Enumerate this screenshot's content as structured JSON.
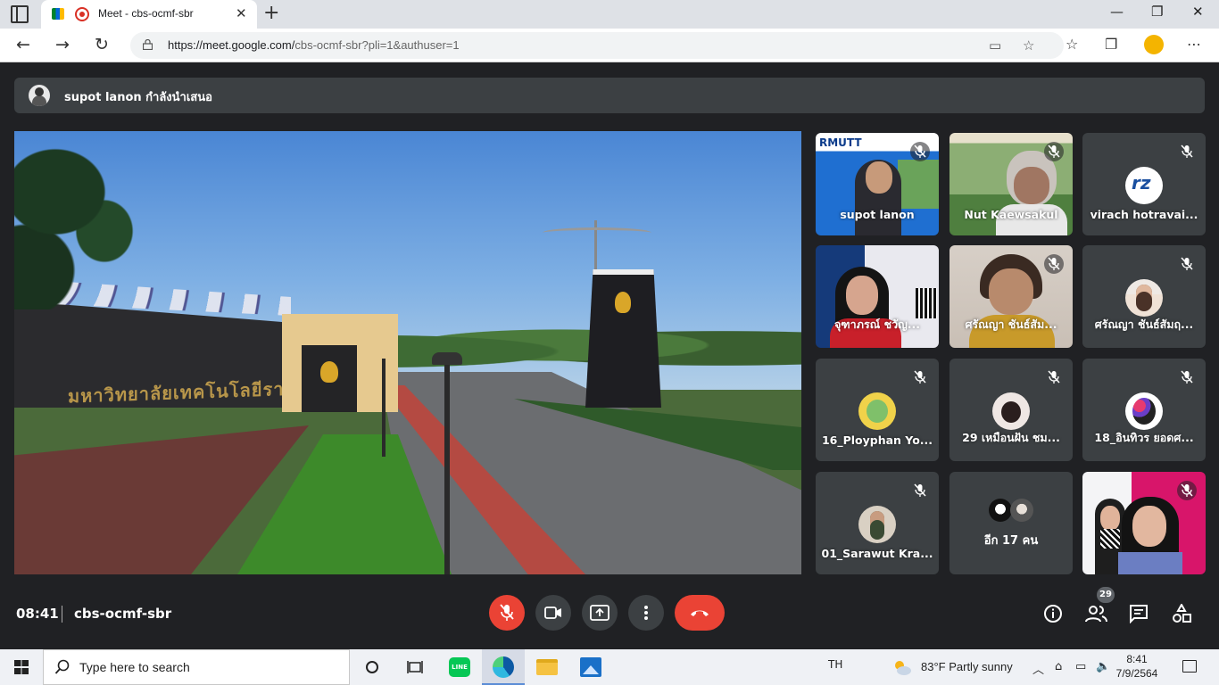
{
  "browser": {
    "tab_title": "Meet - cbs-ocmf-sbr",
    "url_host": "https://meet.google.com/",
    "url_path": "cbs-ocmf-sbr?pli=1&authuser=1"
  },
  "meet": {
    "presenting_text": "supot lanon กำลังนำเสนอ",
    "main_video_sign_text": "มหาวิทยาลัยเทคโนโลยีราชมงคลธัญบุรี",
    "tiles": [
      {
        "name": "supot lanon",
        "muted": true,
        "type": "video",
        "logo": "RMUTT"
      },
      {
        "name": "Nut Kaewsakul",
        "muted": true,
        "type": "video"
      },
      {
        "name": "virach hotravai...",
        "muted": true,
        "type": "avatar"
      },
      {
        "name": "จุฑาภรณ์ ชวัญ...",
        "muted": false,
        "type": "video"
      },
      {
        "name": "ศรัณญา ชันธ์สัม...",
        "muted": true,
        "type": "video"
      },
      {
        "name": "ศรัณญา ชันธ์สัมฤ...",
        "muted": true,
        "type": "avatar"
      },
      {
        "name": "16_Ployphan Yo...",
        "muted": true,
        "type": "avatar"
      },
      {
        "name": "29 เหมือนฝัน ชม...",
        "muted": true,
        "type": "avatar"
      },
      {
        "name": "18_อินทิวร ยอดศ...",
        "muted": true,
        "type": "avatar"
      },
      {
        "name": "01_Sarawut Kra...",
        "muted": true,
        "type": "avatar"
      },
      {
        "name": "อีก 17 คน",
        "muted": false,
        "type": "more"
      },
      {
        "name": "",
        "muted": true,
        "type": "video"
      }
    ],
    "time": "08:41",
    "meeting_code": "cbs-ocmf-sbr",
    "people_count": "29",
    "colors": {
      "end_call": "#ea4335",
      "bg": "#202124",
      "tile": "#3c4043"
    }
  },
  "taskbar": {
    "search_placeholder": "Type here to search",
    "language": "TH",
    "weather": "83°F  Partly sunny",
    "time": "8:41",
    "date": "7/9/2564",
    "line_label": "LINE"
  }
}
